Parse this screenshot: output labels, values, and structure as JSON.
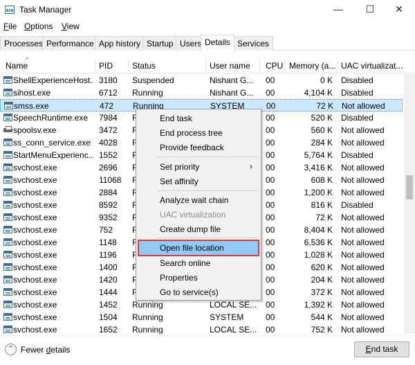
{
  "window": {
    "title": "Task Manager",
    "minimize_icon": "minimize-icon",
    "maximize_icon": "maximize-icon",
    "close_icon": "close-icon"
  },
  "menu": {
    "file": {
      "u": "F",
      "rest": "ile"
    },
    "options": {
      "u": "O",
      "rest": "ptions"
    },
    "view": {
      "u": "V",
      "rest": "iew"
    }
  },
  "tabs": [
    "Processes",
    "Performance",
    "App history",
    "Startup",
    "Users",
    "Details",
    "Services"
  ],
  "active_tab": "Details",
  "columns": [
    "Name",
    "PID",
    "Status",
    "User name",
    "CPU",
    "Memory (a...",
    "UAC virtualizat..."
  ],
  "rows": [
    {
      "name": "ShellExperienceHost....",
      "pid": "3180",
      "status": "Suspended",
      "user": "Nishant G...",
      "cpu": "00",
      "memory": "0 K",
      "uac": "Disabled"
    },
    {
      "name": "sihost.exe",
      "pid": "6712",
      "status": "Running",
      "user": "Nishant G...",
      "cpu": "00",
      "memory": "4,104 K",
      "uac": "Disabled"
    },
    {
      "name": "smss.exe",
      "pid": "472",
      "status": "Running",
      "user": "SYSTEM",
      "cpu": "00",
      "memory": "72 K",
      "uac": "Not allowed"
    },
    {
      "name": "SpeechRuntime.exe",
      "pid": "7984",
      "status": "R",
      "user": "",
      "cpu": "00",
      "memory": "520 K",
      "uac": "Disabled"
    },
    {
      "name": "spoolsv.exe",
      "pid": "3472",
      "status": "R",
      "user": "",
      "cpu": "00",
      "memory": "560 K",
      "uac": "Not allowed"
    },
    {
      "name": "ss_conn_service.exe",
      "pid": "4028",
      "status": "R",
      "user": "",
      "cpu": "00",
      "memory": "284 K",
      "uac": "Not allowed"
    },
    {
      "name": "StartMenuExperienc...",
      "pid": "1552",
      "status": "R",
      "user": "",
      "cpu": "00",
      "memory": "5,764 K",
      "uac": "Disabled"
    },
    {
      "name": "svchost.exe",
      "pid": "2696",
      "status": "R",
      "user": "",
      "cpu": "00",
      "memory": "3,416 K",
      "uac": "Not allowed"
    },
    {
      "name": "svchost.exe",
      "pid": "11068",
      "status": "R",
      "user": "",
      "cpu": "00",
      "memory": "608 K",
      "uac": "Not allowed"
    },
    {
      "name": "svchost.exe",
      "pid": "2884",
      "status": "R",
      "user": "",
      "cpu": "00",
      "memory": "1,200 K",
      "uac": "Not allowed"
    },
    {
      "name": "svchost.exe",
      "pid": "8592",
      "status": "R",
      "user": "",
      "cpu": "00",
      "memory": "816 K",
      "uac": "Disabled"
    },
    {
      "name": "svchost.exe",
      "pid": "9352",
      "status": "R",
      "user": "",
      "cpu": "00",
      "memory": "72 K",
      "uac": "Not allowed"
    },
    {
      "name": "svchost.exe",
      "pid": "752",
      "status": "R",
      "user": "",
      "cpu": "00",
      "memory": "8,404 K",
      "uac": "Not allowed"
    },
    {
      "name": "svchost.exe",
      "pid": "1148",
      "status": "R",
      "user": "",
      "cpu": "00",
      "memory": "6,536 K",
      "uac": "Not allowed"
    },
    {
      "name": "svchost.exe",
      "pid": "1196",
      "status": "R",
      "user": "",
      "cpu": "00",
      "memory": "1,028 K",
      "uac": "Not allowed"
    },
    {
      "name": "svchost.exe",
      "pid": "1400",
      "status": "R",
      "user": "",
      "cpu": "00",
      "memory": "620 K",
      "uac": "Not allowed"
    },
    {
      "name": "svchost.exe",
      "pid": "1420",
      "status": "R",
      "user": "",
      "cpu": "00",
      "memory": "204 K",
      "uac": "Not allowed"
    },
    {
      "name": "svchost.exe",
      "pid": "1444",
      "status": "R",
      "user": "",
      "cpu": "00",
      "memory": "372 K",
      "uac": "Not allowed"
    },
    {
      "name": "svchost.exe",
      "pid": "1452",
      "status": "Running",
      "user": "LOCAL SE...",
      "cpu": "00",
      "memory": "1,392 K",
      "uac": "Not allowed"
    },
    {
      "name": "svchost.exe",
      "pid": "1504",
      "status": "Running",
      "user": "SYSTEM",
      "cpu": "00",
      "memory": "544 K",
      "uac": "Not allowed"
    },
    {
      "name": "svchost.exe",
      "pid": "1652",
      "status": "Running",
      "user": "LOCAL SE...",
      "cpu": "00",
      "memory": "752 K",
      "uac": "Not allowed"
    }
  ],
  "selected_row": 2,
  "context_menu": {
    "end_task": "End task",
    "end_process_tree": "End process tree",
    "provide_feedback": "Provide feedback",
    "set_priority": "Set priority",
    "set_affinity": "Set affinity",
    "analyze_wait_chain": "Analyze wait chain",
    "uac_virtualization": "UAC virtualization",
    "create_dump_file": "Create dump file",
    "open_file_location": "Open file location",
    "search_online": "Search online",
    "properties": "Properties",
    "go_to_services": "Go to service(s)"
  },
  "footer": {
    "fewer_details": {
      "pre": "Fewer ",
      "u": "d",
      "post": "etails"
    },
    "end_task_button": {
      "u": "E",
      "rest": "nd task"
    }
  },
  "colors": {
    "selection_bg": "#cce8ff",
    "highlight_bg": "#91c9f7",
    "highlight_border": "#e53935"
  }
}
